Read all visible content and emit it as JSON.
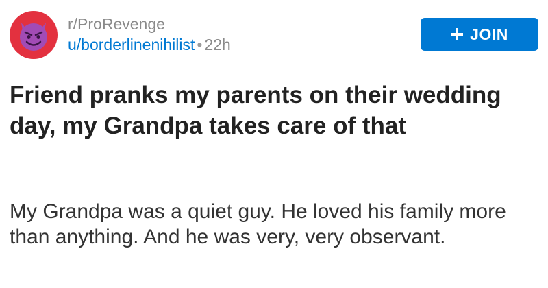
{
  "header": {
    "subreddit": "r/ProRevenge",
    "username": "u/borderlinenihilist",
    "separator": "•",
    "time_ago": "22h",
    "join_label": "JOIN",
    "avatar_icon": "smiling-devil-icon",
    "join_icon": "plus-icon"
  },
  "post": {
    "title": "Friend pranks my parents on their wedding day, my Grandpa takes care of that",
    "body": "My Grandpa was a quiet guy. He loved his family more than anything. And he was very, very observant."
  },
  "colors": {
    "accent": "#0079d3",
    "avatar_background": "#e3313f",
    "devil_face": "#a24bb5",
    "muted_text": "#8a8a8a"
  }
}
